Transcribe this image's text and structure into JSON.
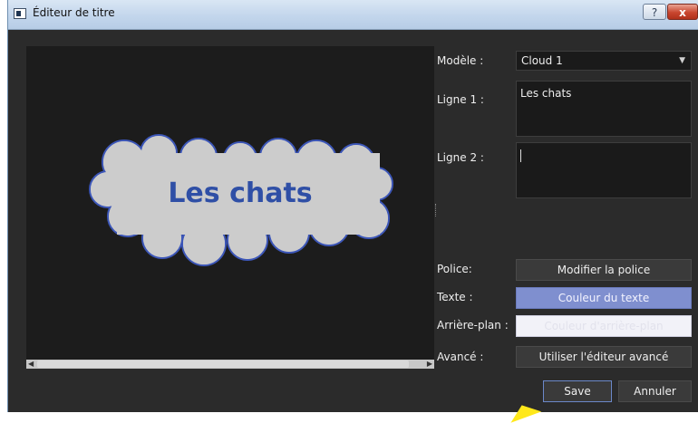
{
  "window": {
    "title": "Éditeur de titre",
    "help_label": "?",
    "close_label": "x"
  },
  "preview": {
    "cloud_text": "Les chats",
    "colors": {
      "canvas": "#1c1c1c",
      "cloud_fill": "#cccccc",
      "cloud_stroke": "#3c56b8",
      "text": "#2f4fa6"
    }
  },
  "form": {
    "model_label": "Modèle :",
    "model_value": "Cloud 1",
    "line1_label": "Ligne 1 :",
    "line1_value": "Les chats",
    "line2_label": "Ligne 2 :",
    "line2_value": "",
    "font_label": "Police:",
    "font_button": "Modifier la police",
    "text_label": "Texte :",
    "text_color_button": "Couleur du texte",
    "background_label": "Arrière-plan :",
    "background_button": "Couleur d'arrière-plan",
    "advanced_label": "Avancé :",
    "advanced_button": "Utiliser l'éditeur avancé"
  },
  "actions": {
    "save": "Save",
    "cancel": "Annuler"
  }
}
